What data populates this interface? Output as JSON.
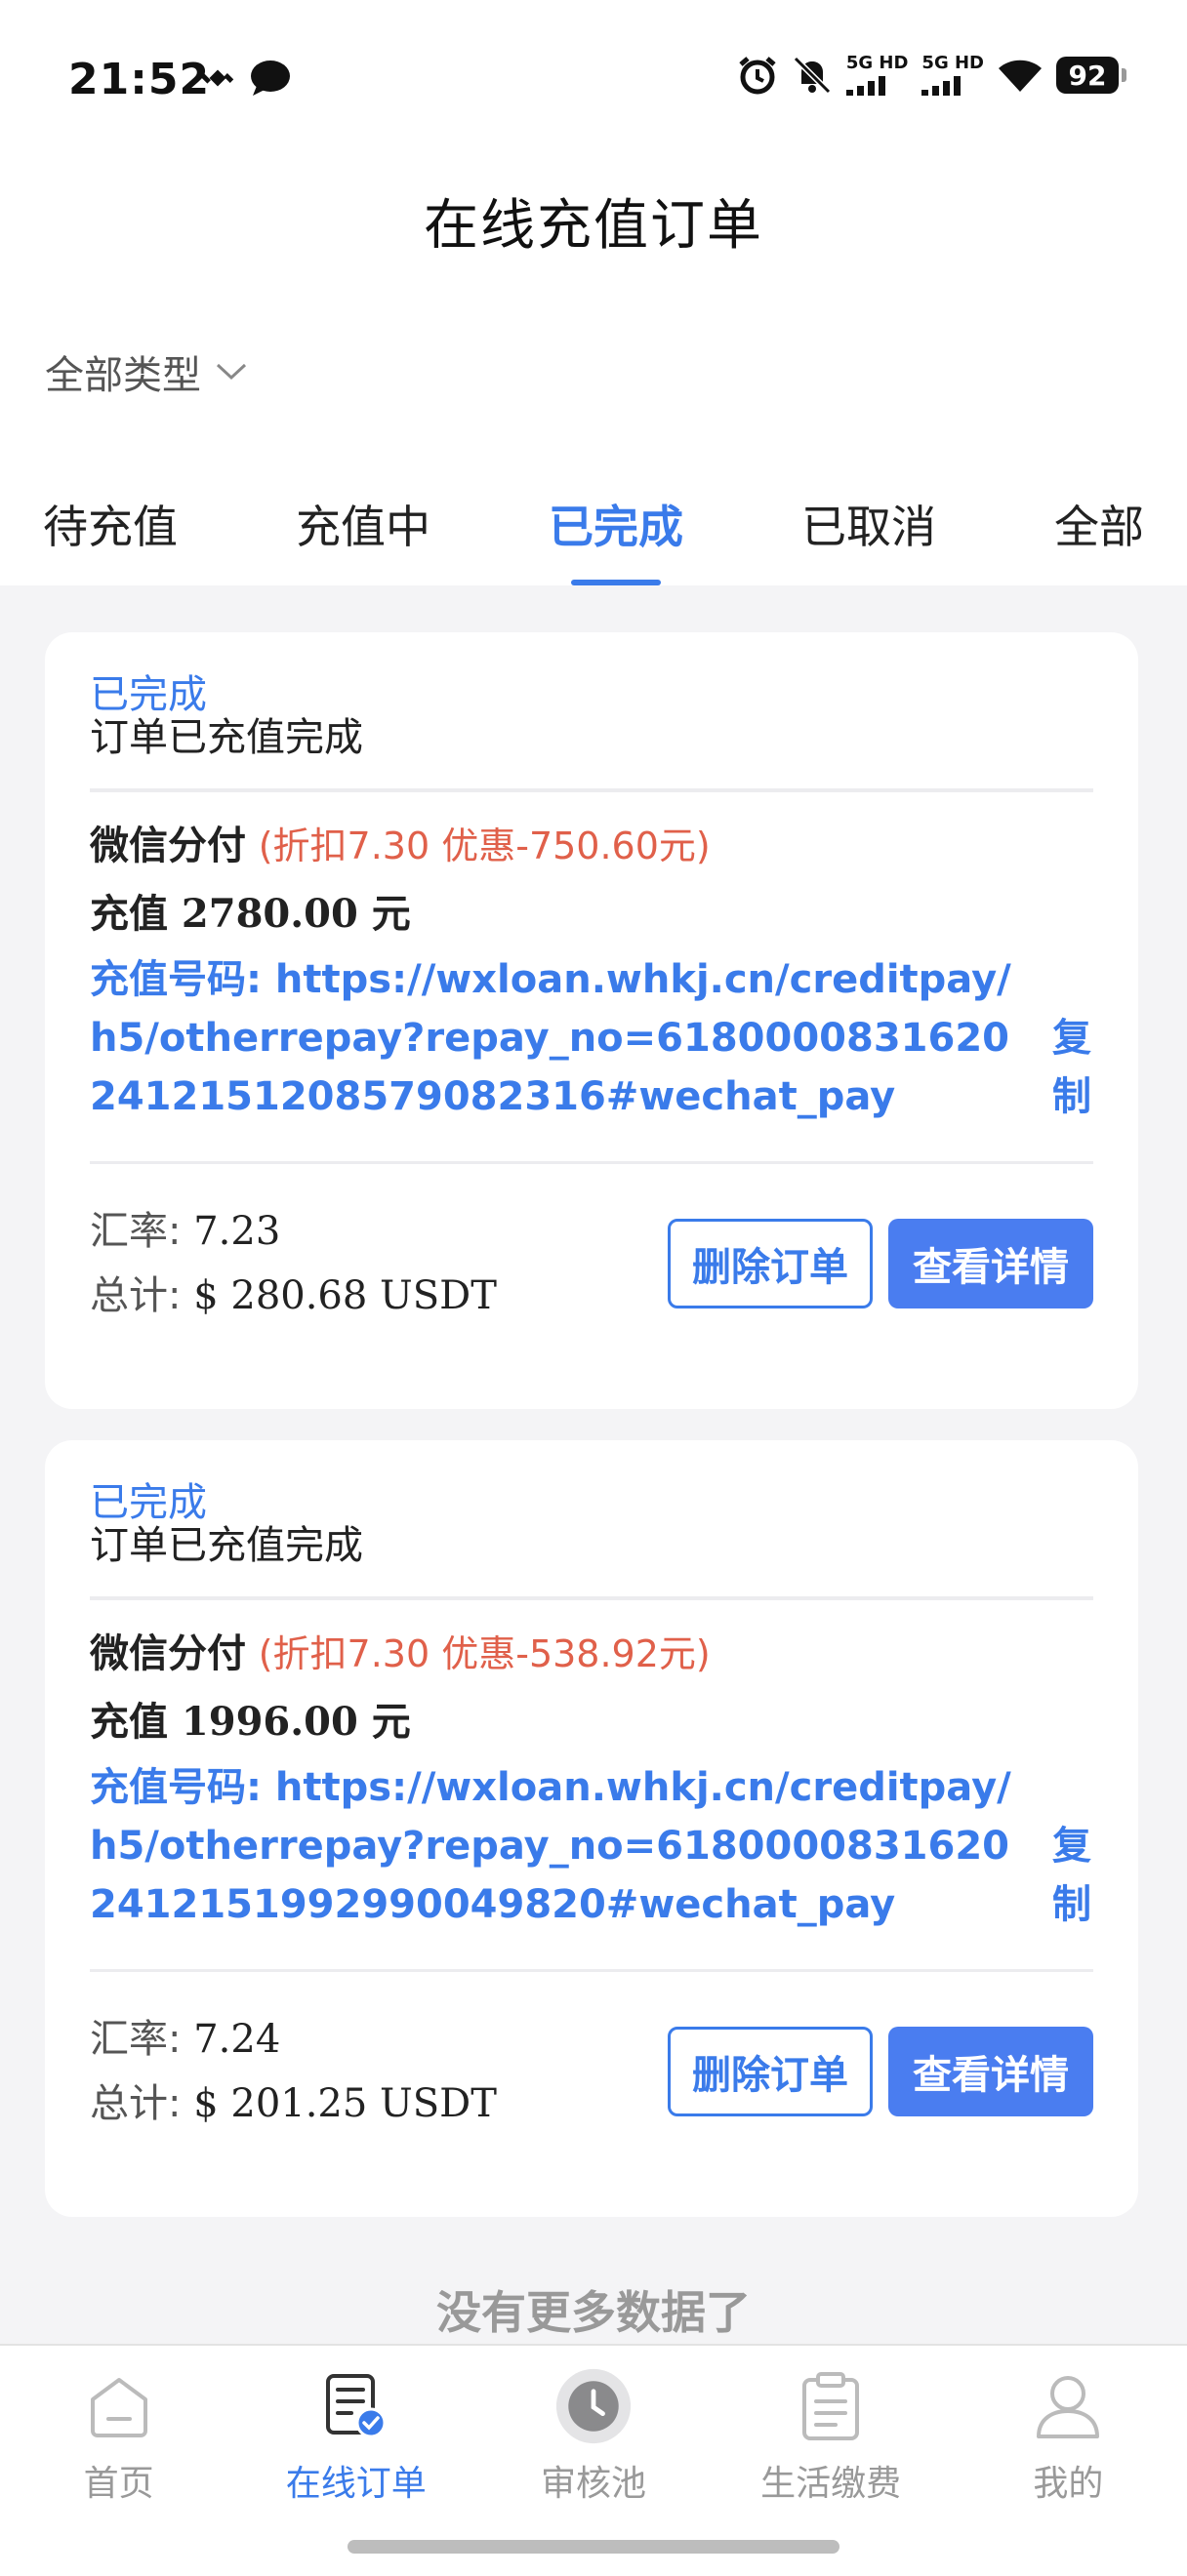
{
  "status_bar": {
    "time": "21:52",
    "network1": "5G HD",
    "network2": "5G HD",
    "battery": "92",
    "icons": [
      "satellite-icon",
      "chat-bubble-icon",
      "alarm-icon",
      "bell-muted-icon",
      "wifi-icon"
    ]
  },
  "header": {
    "title": "在线充值订单"
  },
  "filter": {
    "label": "全部类型"
  },
  "tabs": [
    {
      "label": "待充值",
      "active": false
    },
    {
      "label": "充值中",
      "active": false
    },
    {
      "label": "已完成",
      "active": true
    },
    {
      "label": "已取消",
      "active": false
    },
    {
      "label": "全部",
      "active": false
    }
  ],
  "orders": [
    {
      "status": "已完成",
      "status_desc": "订单已充值完成",
      "pay_method": "微信分付",
      "discount": "(折扣7.30 优惠-750.60元)",
      "amount": "充值 2780.00 元",
      "recharge_label": "充值号码: ",
      "recharge_no": "https://wxloan.whkj.cn/creditpay/h5/otherrepay?repay_no=61800008316202412151208579082316#wechat_pay",
      "copy_label": "复制",
      "rate_label": "汇率: ",
      "rate": "7.23",
      "total_label": "总计: ",
      "total": "$ 280.68 USDT",
      "delete_label": "删除订单",
      "detail_label": "查看详情"
    },
    {
      "status": "已完成",
      "status_desc": "订单已充值完成",
      "pay_method": "微信分付",
      "discount": "(折扣7.30 优惠-538.92元)",
      "amount": "充值 1996.00 元",
      "recharge_label": "充值号码: ",
      "recharge_no": "https://wxloan.whkj.cn/creditpay/h5/otherrepay?repay_no=61800008316202412151992990049820#wechat_pay",
      "copy_label": "复制",
      "rate_label": "汇率: ",
      "rate": "7.24",
      "total_label": "总计: ",
      "total": "$ 201.25 USDT",
      "delete_label": "删除订单",
      "detail_label": "查看详情"
    }
  ],
  "no_more": "没有更多数据了",
  "nav": [
    {
      "label": "首页",
      "icon": "home-icon",
      "active": false
    },
    {
      "label": "在线订单",
      "icon": "order-list-icon",
      "active": true
    },
    {
      "label": "审核池",
      "icon": "clock-icon",
      "active": false
    },
    {
      "label": "生活缴费",
      "icon": "clipboard-icon",
      "active": false
    },
    {
      "label": "我的",
      "icon": "user-icon",
      "active": false
    }
  ],
  "colors": {
    "accent": "#3a7bea",
    "discount": "#e0604a",
    "background": "#f4f4f6"
  }
}
